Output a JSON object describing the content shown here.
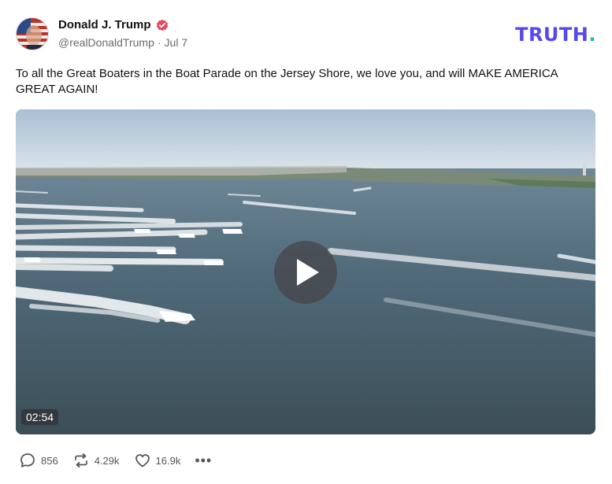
{
  "author": {
    "display_name": "Donald J. Trump",
    "handle": "@realDonaldTrump",
    "separator": "·",
    "date": "Jul 7"
  },
  "brand": {
    "logo_text": "TRUTH",
    "logo_dot": ".",
    "logo_color": "#5448EE",
    "dot_color": "#0FC4A5"
  },
  "post": {
    "text": "To all the Great Boaters in the Boat Parade on the Jersey Shore, we love you, and will MAKE AMERICA GREAT AGAIN!"
  },
  "video": {
    "duration": "02:54"
  },
  "actions": {
    "replies": "856",
    "retruths": "4.29k",
    "likes": "16.9k",
    "more": "•••"
  },
  "icons": [
    "verified-badge-icon",
    "play-icon",
    "reply-icon",
    "retruth-icon",
    "heart-icon",
    "more-icon"
  ]
}
